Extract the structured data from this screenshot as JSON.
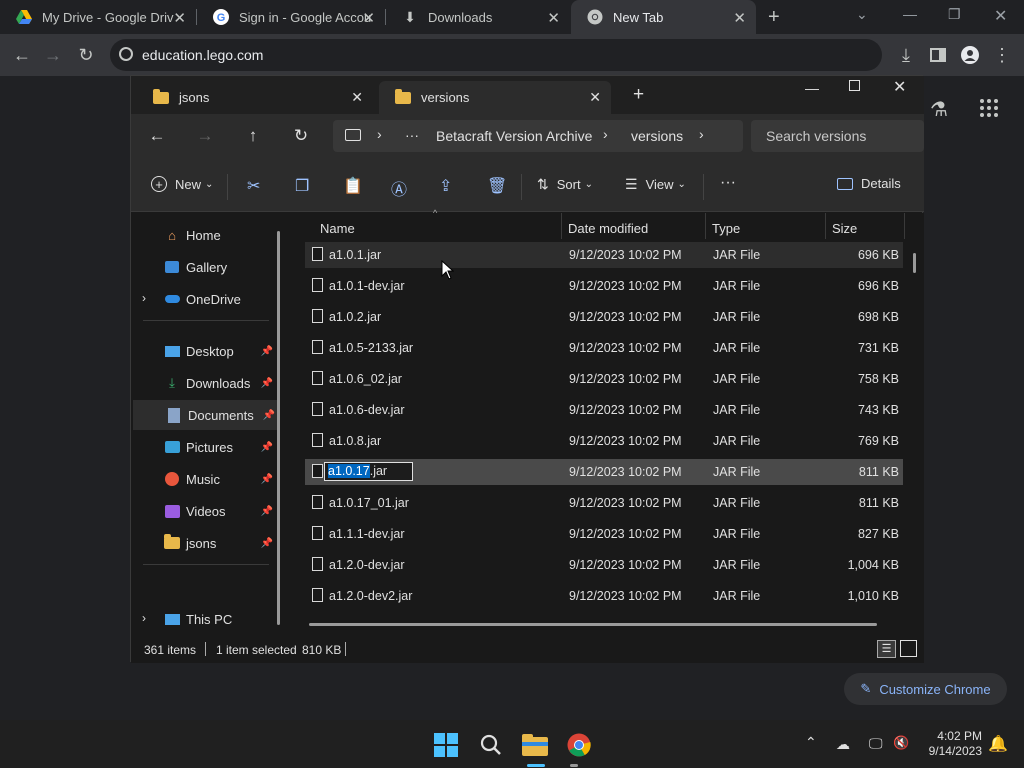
{
  "chrome": {
    "tabs": [
      {
        "title": "My Drive - Google Driv",
        "icon": "google-drive-icon"
      },
      {
        "title": "Sign in - Google Accou",
        "icon": "google-g-icon"
      },
      {
        "title": "Downloads",
        "icon": "download-icon"
      },
      {
        "title": "New Tab",
        "icon": "chrome-icon"
      }
    ],
    "url": "education.lego.com",
    "customize_label": "Customize Chrome"
  },
  "explorer": {
    "tabs": [
      {
        "title": "jsons"
      },
      {
        "title": "versions"
      }
    ],
    "breadcrumb": {
      "ellipsis": "···",
      "items": [
        "Betacraft Version Archive",
        "versions"
      ]
    },
    "search_placeholder": "Search versions",
    "commands": {
      "new": "New",
      "sort": "Sort",
      "view": "View",
      "more": "···",
      "details": "Details"
    },
    "sidebar": {
      "top": [
        {
          "label": "Home"
        },
        {
          "label": "Gallery"
        },
        {
          "label": "OneDrive"
        }
      ],
      "pinned": [
        {
          "label": "Desktop"
        },
        {
          "label": "Downloads"
        },
        {
          "label": "Documents"
        },
        {
          "label": "Pictures"
        },
        {
          "label": "Music"
        },
        {
          "label": "Videos"
        },
        {
          "label": "jsons"
        }
      ],
      "bottom": [
        {
          "label": "This PC"
        }
      ]
    },
    "columns": {
      "name": "Name",
      "date": "Date modified",
      "type": "Type",
      "size": "Size"
    },
    "files": [
      {
        "name": "a1.0.1.jar",
        "date": "9/12/2023 10:02 PM",
        "type": "JAR File",
        "size": "696 KB"
      },
      {
        "name": "a1.0.1-dev.jar",
        "date": "9/12/2023 10:02 PM",
        "type": "JAR File",
        "size": "696 KB"
      },
      {
        "name": "a1.0.2.jar",
        "date": "9/12/2023 10:02 PM",
        "type": "JAR File",
        "size": "698 KB"
      },
      {
        "name": "a1.0.5-2133.jar",
        "date": "9/12/2023 10:02 PM",
        "type": "JAR File",
        "size": "731 KB"
      },
      {
        "name": "a1.0.6_02.jar",
        "date": "9/12/2023 10:02 PM",
        "type": "JAR File",
        "size": "758 KB"
      },
      {
        "name": "a1.0.6-dev.jar",
        "date": "9/12/2023 10:02 PM",
        "type": "JAR File",
        "size": "743 KB"
      },
      {
        "name": "a1.0.8.jar",
        "date": "9/12/2023 10:02 PM",
        "type": "JAR File",
        "size": "769 KB"
      },
      {
        "name": "a1.0.17.jar",
        "date": "9/12/2023 10:02 PM",
        "type": "JAR File",
        "size": "811 KB"
      },
      {
        "name": "a1.0.17_01.jar",
        "date": "9/12/2023 10:02 PM",
        "type": "JAR File",
        "size": "811 KB"
      },
      {
        "name": "a1.1.1-dev.jar",
        "date": "9/12/2023 10:02 PM",
        "type": "JAR File",
        "size": "827 KB"
      },
      {
        "name": "a1.2.0-dev.jar",
        "date": "9/12/2023 10:02 PM",
        "type": "JAR File",
        "size": "1,004 KB"
      },
      {
        "name": "a1.2.0-dev2.jar",
        "date": "9/12/2023 10:02 PM",
        "type": "JAR File",
        "size": "1,010 KB"
      }
    ],
    "rename": {
      "selected_part": "a1.0.17",
      "extension": ".jar"
    },
    "status": {
      "items_count": "361 items",
      "selected": "1 item selected",
      "selected_size": "810 KB"
    }
  },
  "taskbar": {
    "time": "4:02 PM",
    "date": "9/14/2023"
  }
}
